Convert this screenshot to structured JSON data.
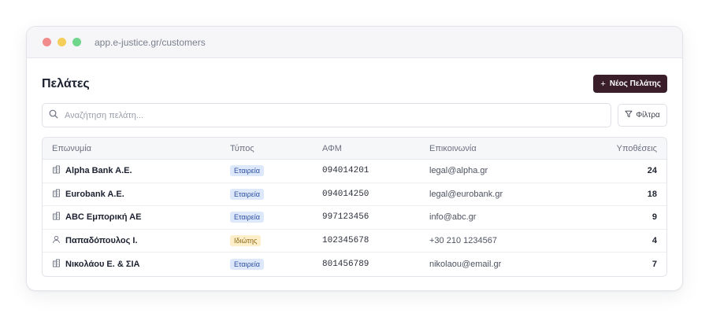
{
  "browser": {
    "url": "app.e-justice.gr/customers"
  },
  "page": {
    "title": "Πελάτες",
    "new_button_label": "Νέος Πελάτης"
  },
  "search": {
    "placeholder": "Αναζήτηση πελάτη...",
    "value": ""
  },
  "filters": {
    "label": "Φίλτρα"
  },
  "table": {
    "headers": {
      "name": "Επωνυμία",
      "type": "Τύπος",
      "afm": "ΑΦΜ",
      "contact": "Επικοινωνία",
      "cases": "Υποθέσεις"
    },
    "rows": [
      {
        "icon": "building-icon",
        "name": "Alpha Bank A.E.",
        "type": "Εταιρεία",
        "afm": "094014201",
        "contact": "legal@alpha.gr",
        "cases": "24"
      },
      {
        "icon": "building-icon",
        "name": "Eurobank A.E.",
        "type": "Εταιρεία",
        "afm": "094014250",
        "contact": "legal@eurobank.gr",
        "cases": "18"
      },
      {
        "icon": "building-icon",
        "name": "ABC Εμπορική ΑΕ",
        "type": "Εταιρεία",
        "afm": "997123456",
        "contact": "info@abc.gr",
        "cases": "9"
      },
      {
        "icon": "person-icon",
        "name": "Παπαδόπουλος Ι.",
        "type": "Ιδιώτης",
        "afm": "102345678",
        "contact": "+30 210 1234567",
        "cases": "4"
      },
      {
        "icon": "building-icon",
        "name": "Νικολάου Ε. & ΣΙΑ",
        "type": "Εταιρεία",
        "afm": "801456789",
        "contact": "nikolaou@email.gr",
        "cases": "7"
      }
    ]
  },
  "colors": {
    "primary": "#3a1f2b",
    "company_badge_bg": "#dde8fb",
    "company_badge_text": "#2d4f9e",
    "private_badge_bg": "#fbeec9",
    "private_badge_text": "#8c6410"
  }
}
